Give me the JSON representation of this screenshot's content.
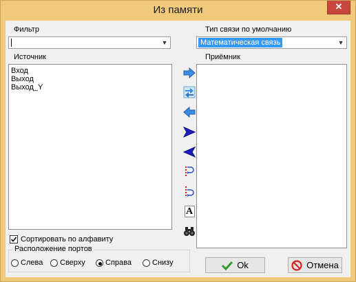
{
  "window": {
    "title": "Из памяти",
    "close_glyph": "✕"
  },
  "filter": {
    "label": "Фильтр",
    "value": ""
  },
  "link_type": {
    "label": "Тип связи по умолчанию",
    "selected": "Математическая связь"
  },
  "source": {
    "label": "Источник",
    "items": [
      "Вход",
      "Выход",
      "Выход_Y"
    ]
  },
  "receiver": {
    "label": "Приёмник",
    "items": []
  },
  "toolbar": {
    "buttons": [
      "arrow-right-icon",
      "swap-icon",
      "arrow-left-icon",
      "triangle-right-icon",
      "triangle-left-icon",
      "port-loop-right-icon",
      "port-loop-left-icon",
      "font-a-icon",
      "binoculars-icon"
    ],
    "font_glyph": "A"
  },
  "sort": {
    "label": "Сортировать по алфавиту",
    "checked": true
  },
  "ports": {
    "legend": "Расположение портов",
    "options": [
      "Слева",
      "Сверху",
      "Справа",
      "Снизу"
    ],
    "selected": "Справа"
  },
  "ok": {
    "label": "Ok"
  },
  "cancel": {
    "label": "Отмена"
  },
  "colors": {
    "title_bar": "#f0c97b",
    "close": "#c7463d",
    "selection": "#3399ff"
  }
}
